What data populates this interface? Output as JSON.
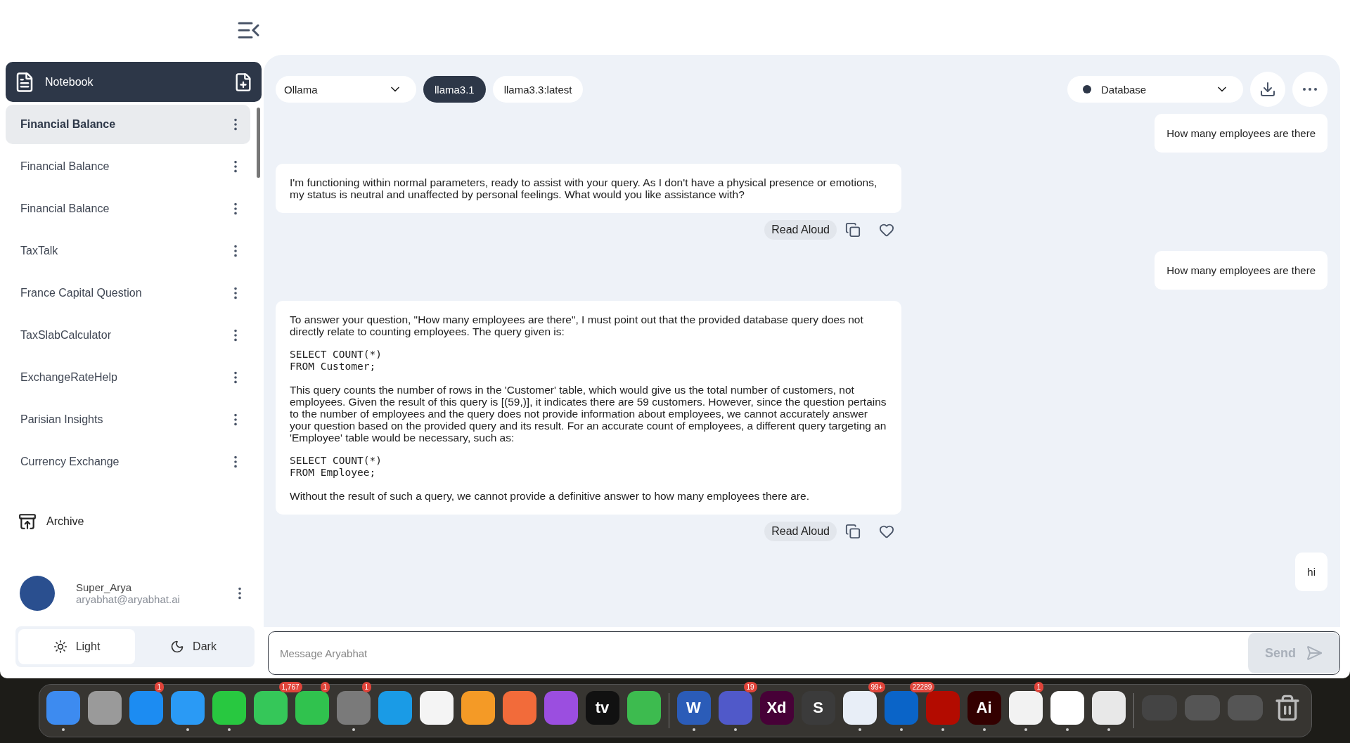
{
  "sidebar": {
    "notebook": {
      "title": "Notebook"
    },
    "items": [
      {
        "title": "Financial Balance",
        "selected": true
      },
      {
        "title": "Financial Balance",
        "selected": false
      },
      {
        "title": "Financial Balance",
        "selected": false
      },
      {
        "title": "TaxTalk",
        "selected": false
      },
      {
        "title": "France Capital Question",
        "selected": false
      },
      {
        "title": "TaxSlabCalculator",
        "selected": false
      },
      {
        "title": "ExchangeRateHelp",
        "selected": false
      },
      {
        "title": "Parisian Insights",
        "selected": false
      },
      {
        "title": "Currency Exchange",
        "selected": false
      }
    ],
    "archive": "Archive",
    "user": {
      "name": "Super_Arya",
      "email": "aryabhat@aryabhat.ai"
    },
    "theme": [
      {
        "label": "Light",
        "kind": "light",
        "selected": true
      },
      {
        "label": "Dark",
        "kind": "dark",
        "selected": false
      }
    ]
  },
  "toolbar": {
    "provider": "Ollama",
    "models": [
      {
        "label": "llama3.1",
        "selected": true
      },
      {
        "label": "llama3.3:latest",
        "selected": false
      }
    ],
    "source": "Database"
  },
  "messages": [
    {
      "kind": "user",
      "text": "How many employees are there"
    },
    {
      "kind": "assistant",
      "blocks": [
        {
          "kind": "text",
          "text": "I'm functioning within normal parameters, ready to assist with your query. As I don't have a physical presence or emotions, my status is neutral and unaffected by personal feelings. What would you like assistance with?"
        }
      ],
      "read_aloud": "Read Aloud"
    },
    {
      "kind": "user",
      "text": "How many employees are there"
    },
    {
      "kind": "assistant",
      "blocks": [
        {
          "kind": "text",
          "text": "To answer your question, \"How many employees are there\", I must point out that the provided database query does not directly relate to counting employees. The query given is:"
        },
        {
          "kind": "code",
          "lines": [
            "SELECT COUNT(*)",
            "FROM Customer;"
          ]
        },
        {
          "kind": "text",
          "text": "This query counts the number of rows in the 'Customer' table, which would give us the total number of customers, not employees. Given the result of this query is [(59,)], it indicates there are 59 customers. However, since the question pertains to the number of employees and the query does not provide information about employees, we cannot accurately answer your question based on the provided query and its result. For an accurate count of employees, a different query targeting an 'Employee' table would be necessary, such as:"
        },
        {
          "kind": "code",
          "lines": [
            "SELECT COUNT(*)",
            "FROM Employee;"
          ]
        },
        {
          "kind": "text",
          "text": "Without the result of such a query, we cannot provide a definitive answer to how many employees there are."
        }
      ],
      "read_aloud": "Read Aloud"
    },
    {
      "kind": "user",
      "text": "hi"
    }
  ],
  "composer": {
    "placeholder": "Message Aryabhat",
    "send": "Send"
  },
  "dock": [
    {
      "kind": "app",
      "color": "#3d8bf0",
      "running": true
    },
    {
      "kind": "app",
      "color": "#9a9a9a",
      "running": false
    },
    {
      "kind": "app",
      "color": "#1c8cf2",
      "badge": "1",
      "running": false
    },
    {
      "kind": "app",
      "color": "#2a9af5",
      "running": true
    },
    {
      "kind": "app",
      "color": "#28c840",
      "running": true
    },
    {
      "kind": "app",
      "color": "#35c759",
      "badge": "1,767",
      "running": false
    },
    {
      "kind": "app",
      "color": "#30c24e",
      "badge": "1",
      "running": false
    },
    {
      "kind": "app",
      "color": "#7a7a7a",
      "badge": "1",
      "running": true
    },
    {
      "kind": "app",
      "color": "#1a9be6",
      "running": false
    },
    {
      "kind": "app",
      "color": "#f4f4f4",
      "running": false
    },
    {
      "kind": "app",
      "color": "#f49a26",
      "running": false
    },
    {
      "kind": "app",
      "color": "#f26b3a",
      "running": false
    },
    {
      "kind": "app",
      "color": "#9b4ee0",
      "running": false
    },
    {
      "kind": "app",
      "color": "#111111",
      "label": "tv",
      "running": false
    },
    {
      "kind": "app",
      "color": "#3dbb4f",
      "running": false
    },
    {
      "kind": "separator"
    },
    {
      "kind": "app",
      "color": "#2b5cb8",
      "label": "W",
      "running": true
    },
    {
      "kind": "app",
      "color": "#5059c9",
      "badge": "19",
      "running": true
    },
    {
      "kind": "app",
      "color": "#470137",
      "label": "Xd",
      "running": false
    },
    {
      "kind": "app",
      "color": "#3b3b3b",
      "label": "S",
      "running": false
    },
    {
      "kind": "app",
      "color": "#e8eef7",
      "badge": "99+",
      "running": true
    },
    {
      "kind": "app",
      "color": "#0a64c8",
      "badge": "22289",
      "running": true
    },
    {
      "kind": "app",
      "color": "#b30b00",
      "running": true
    },
    {
      "kind": "app",
      "color": "#330000",
      "label": "Ai",
      "running": true
    },
    {
      "kind": "app",
      "color": "#f2f2f2",
      "badge": "1",
      "running": true
    },
    {
      "kind": "app",
      "color": "#ffffff",
      "running": true
    },
    {
      "kind": "app",
      "color": "#e8e8e8",
      "running": true
    },
    {
      "kind": "separator"
    },
    {
      "kind": "window",
      "color": "#444444",
      "running": false
    },
    {
      "kind": "window",
      "color": "#555555",
      "running": false
    },
    {
      "kind": "window",
      "color": "#555555",
      "running": false
    },
    {
      "kind": "trash",
      "color": "#bbbbbb",
      "running": false
    }
  ]
}
